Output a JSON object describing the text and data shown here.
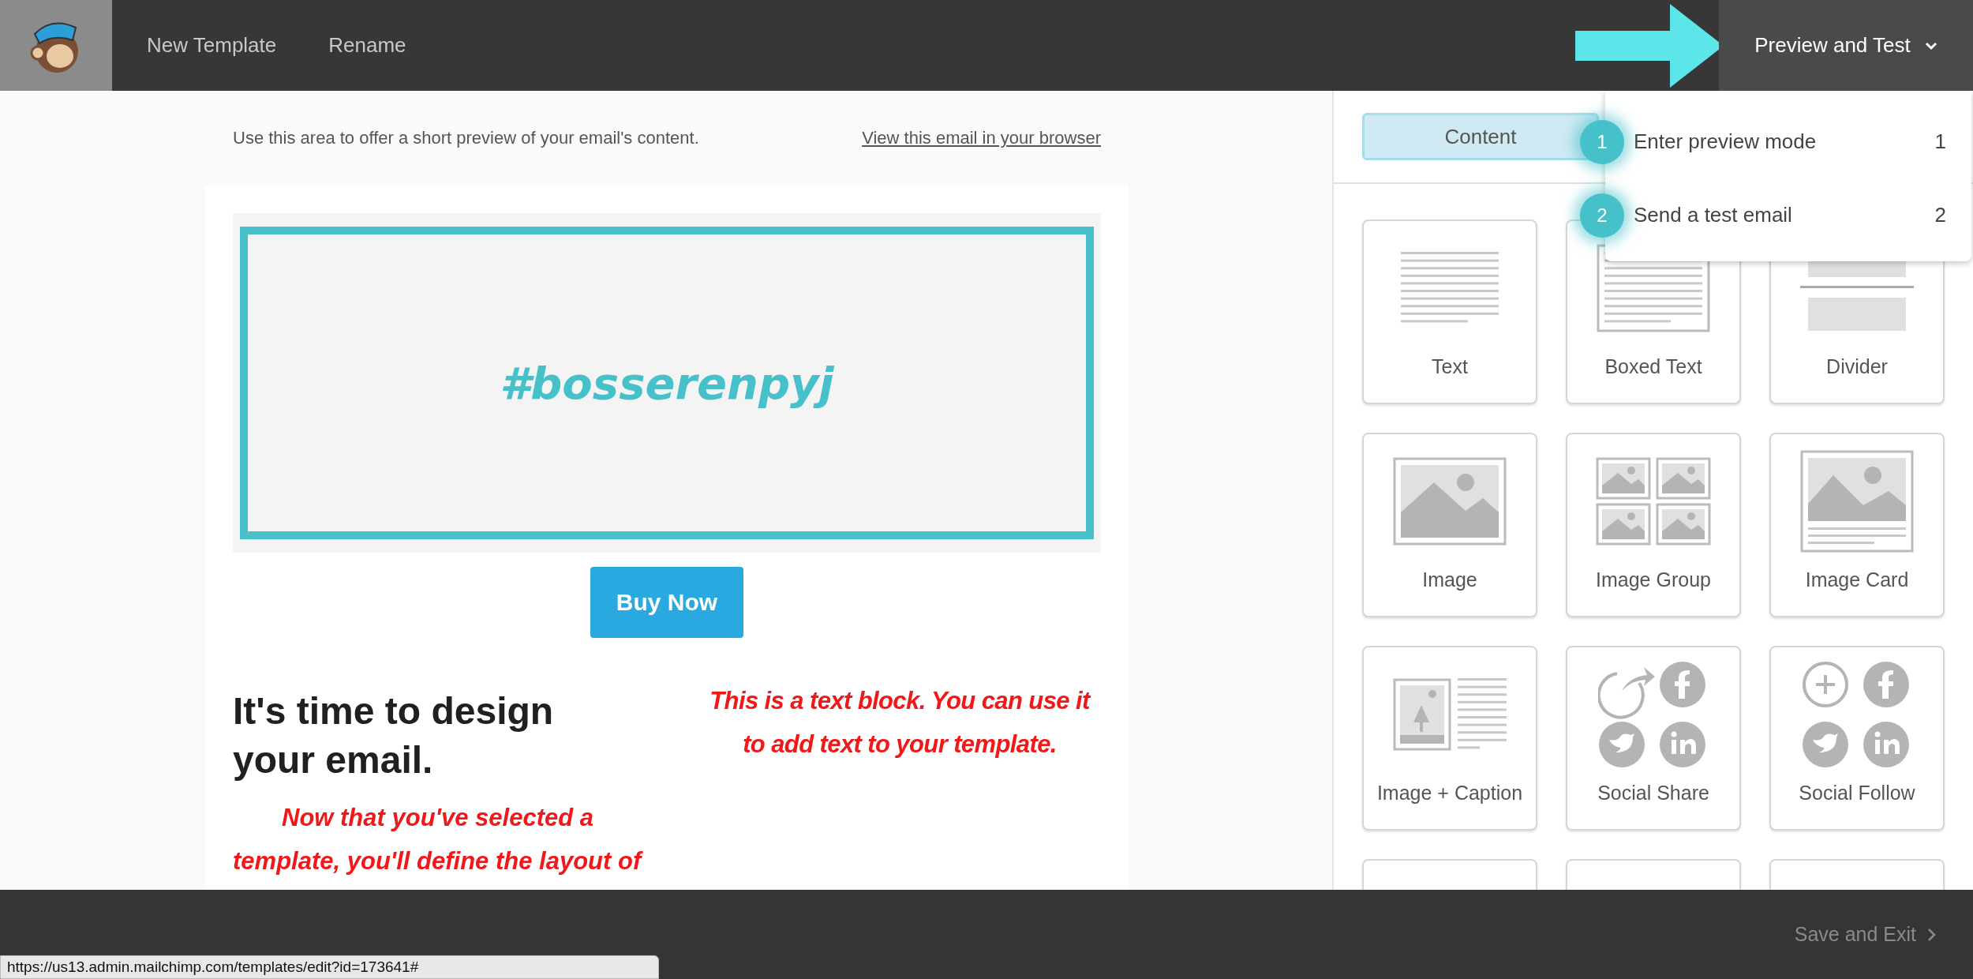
{
  "topbar": {
    "nav": [
      {
        "label": "New Template"
      },
      {
        "label": "Rename"
      }
    ],
    "preview_button": {
      "label": "Preview and Test",
      "expanded": true
    }
  },
  "dropdown": {
    "items": [
      {
        "step": "1",
        "label": "Enter preview mode",
        "shortcut": "1"
      },
      {
        "step": "2",
        "label": "Send a test email",
        "shortcut": "2"
      }
    ]
  },
  "email": {
    "preheader": "Use this area to offer a short preview of your email's content.",
    "browser_link": "View this email in your browser",
    "banner_text": "#bosserenpyj",
    "button": "Buy Now",
    "heading": "It's time to design your email.",
    "left_text": "Now that you've selected a template, you'll define the layout of",
    "right_text": "This is a text block. You can use it to add text to your template."
  },
  "sidebar": {
    "tabs": [
      {
        "label": "Content",
        "selected": true
      }
    ],
    "blocks": [
      {
        "kind": "text",
        "label": "Text"
      },
      {
        "kind": "boxed-text",
        "label": "Boxed Text"
      },
      {
        "kind": "divider",
        "label": "Divider"
      },
      {
        "kind": "image",
        "label": "Image"
      },
      {
        "kind": "image-group",
        "label": "Image Group"
      },
      {
        "kind": "image-card",
        "label": "Image Card"
      },
      {
        "kind": "image-caption",
        "label": "Image + Caption"
      },
      {
        "kind": "social-share",
        "label": "Social Share"
      },
      {
        "kind": "social-follow",
        "label": "Social Follow"
      },
      {
        "kind": "blank"
      },
      {
        "kind": "blank"
      },
      {
        "kind": "blank"
      }
    ]
  },
  "footer": {
    "save": "Save and Exit"
  },
  "status_url": "https://us13.admin.mailchimp.com/templates/edit?id=173641#"
}
